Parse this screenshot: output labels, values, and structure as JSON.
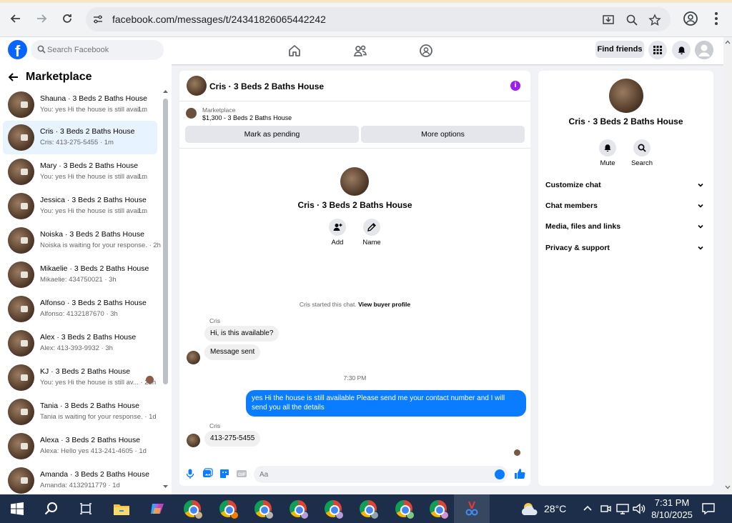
{
  "browser": {
    "url": "facebook.com/messages/t/24341826065442242"
  },
  "header": {
    "search_placeholder": "Search Facebook",
    "find_friends": "Find friends"
  },
  "sidebar": {
    "title": "Marketplace",
    "conversations": [
      {
        "name": "Shauna · 3 Beds 2 Baths House",
        "snippet": "You: yes Hi the house is still avail...",
        "time": "1m"
      },
      {
        "name": "Cris · 3 Beds 2 Baths House",
        "snippet": "Cris: 413-275-5455 · 1m",
        "time": ""
      },
      {
        "name": "Mary · 3 Beds 2 Baths House",
        "snippet": "You: yes Hi the house is still avail...",
        "time": "1m"
      },
      {
        "name": "Jessica · 3 Beds 2 Baths House",
        "snippet": "You: yes Hi the house is still avail...",
        "time": "1m"
      },
      {
        "name": "Noiska · 3 Beds 2 Baths House",
        "snippet": "Noiska is waiting for your response. · 2h",
        "time": ""
      },
      {
        "name": "Mikaelie · 3 Beds 2 Baths House",
        "snippet": "Mikaelie: 434750021 · 3h",
        "time": ""
      },
      {
        "name": "Alfonso · 3 Beds 2 Baths House",
        "snippet": "Alfonso: 4132187670 · 3h",
        "time": ""
      },
      {
        "name": "Alex · 3 Beds 2 Baths House",
        "snippet": "Alex: 413-393-9932 · 3h",
        "time": ""
      },
      {
        "name": "KJ · 3 Beds 2 Baths House",
        "snippet": "You: yes Hi the house is still av... · 23h",
        "time": ""
      },
      {
        "name": "Tania · 3 Beds 2 Baths House",
        "snippet": "Tania is waiting for your response. · 1d",
        "time": ""
      },
      {
        "name": "Alexa · 3 Beds 2 Baths House",
        "snippet": "Alexa: Hello yes 413-241-4605 · 1d",
        "time": ""
      },
      {
        "name": "Amanda · 3 Beds 2 Baths House",
        "snippet": "Amanda: 4132911779 · 1d",
        "time": ""
      }
    ]
  },
  "chat": {
    "title": "Cris · 3 Beds 2 Baths House",
    "marketplace_label": "Marketplace",
    "listing_price": "$1,300 - 3 Beds 2 Baths House",
    "mark_pending": "Mark as pending",
    "more_options": "More options",
    "profile_name": "Cris · 3 Beds 2 Baths House",
    "add_label": "Add",
    "name_label": "Name",
    "system_text": "Cris started this chat.",
    "system_link": "View buyer profile",
    "sender_name": "Cris",
    "msg1": "Hi, is this available?",
    "msg2": "Message sent",
    "timestamp": "7:30 PM",
    "msg_out": "yes Hi the house is still available Please send me your contact number and I will send you all the details",
    "sender_name2": "Cris",
    "msg3": "413-275-5455",
    "composer_placeholder": "Aa"
  },
  "details": {
    "name": "Cris · 3 Beds 2 Baths House",
    "mute": "Mute",
    "search": "Search",
    "sections": [
      "Customize chat",
      "Chat members",
      "Media, files and links",
      "Privacy & support"
    ]
  },
  "taskbar": {
    "temperature": "28°C",
    "time": "7:31 PM",
    "date": "8/10/2025"
  },
  "colors": {
    "fb_blue": "#0866ff",
    "outgoing_bubble": "#0a7cff",
    "info_purple": "#9b1fe8",
    "taskbar": "#1c2e4a"
  }
}
